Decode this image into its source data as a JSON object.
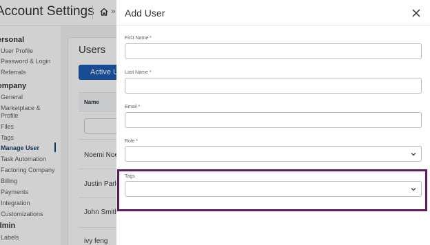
{
  "header": {
    "title": "Account Settings",
    "breadcrumb_sep": "»"
  },
  "sidebar": {
    "sections": [
      {
        "label": "ersonal"
      },
      {
        "label": "ompany"
      },
      {
        "label": "dmin"
      }
    ],
    "items": [
      {
        "label": "User Profile"
      },
      {
        "label": "Password & Login"
      },
      {
        "label": "Referrals"
      },
      {
        "label": "General"
      },
      {
        "label": "Marketplace &"
      },
      {
        "label": "Profile"
      },
      {
        "label": "Files"
      },
      {
        "label": "Tags"
      },
      {
        "label": "Manage User"
      },
      {
        "label": "Task Automation"
      },
      {
        "label": "Factoring Company"
      },
      {
        "label": "Billing"
      },
      {
        "label": "Payments"
      },
      {
        "label": "Integration"
      },
      {
        "label": "Customizations"
      },
      {
        "label": "Labels"
      }
    ]
  },
  "users": {
    "title": "Users",
    "active_button": "Active U",
    "name_column": "Name",
    "rows": [
      {
        "name": "Noemi Noe"
      },
      {
        "name": "Justin Parke"
      },
      {
        "name": "John Smith"
      },
      {
        "name": "ivy feng"
      }
    ]
  },
  "drawer": {
    "title": "Add User",
    "fields": {
      "first_name": {
        "label": "First Name *",
        "value": ""
      },
      "last_name": {
        "label": "Last Name *",
        "value": ""
      },
      "email": {
        "label": "Email *",
        "value": ""
      },
      "role": {
        "label": "Role *",
        "value": ""
      },
      "tags": {
        "label": "Tags",
        "value": ""
      }
    }
  },
  "colors": {
    "primary": "#1e5db3",
    "active_nav": "#17406e",
    "highlight": "#5e1a63"
  },
  "icons": {
    "home": "home-icon",
    "close": "close-icon",
    "select": "chevron-down-icon"
  }
}
